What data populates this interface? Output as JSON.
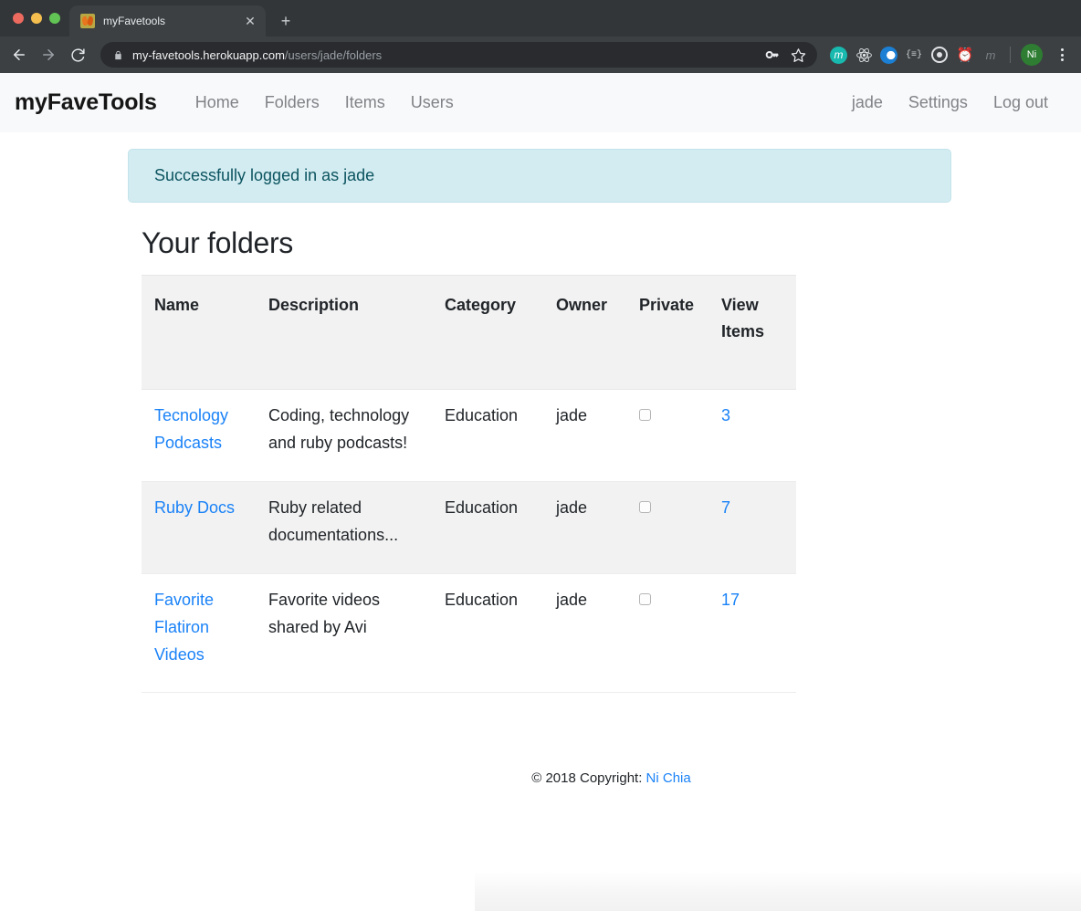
{
  "browser": {
    "tab": {
      "title": "myFavetools",
      "favicon_name": "butterfly-favicon",
      "close_label": "✕"
    },
    "new_tab_label": "+",
    "back_label": "←",
    "forward_label": "→",
    "reload_label": "⟳",
    "omnibox": {
      "domain": "my-favetools.herokuapp.com",
      "path": "/users/jade/folders",
      "lock_icon": "lock-icon"
    },
    "omnibox_actions": [
      {
        "name": "password-key-icon",
        "glyph": "⚷"
      },
      {
        "name": "bookmark-star-icon",
        "glyph": "☆"
      }
    ],
    "extensions": [
      {
        "name": "momentum-extension-icon",
        "glyph": "m"
      },
      {
        "name": "react-devtools-icon",
        "glyph": "⚛"
      },
      {
        "name": "opera-extension-icon",
        "glyph": ""
      },
      {
        "name": "json-formatter-icon",
        "glyph": "{≡}"
      },
      {
        "name": "target-extension-icon",
        "glyph": ""
      },
      {
        "name": "alarm-clock-extension-icon",
        "glyph": "⏰"
      },
      {
        "name": "muted-m-extension-icon",
        "glyph": "m"
      }
    ],
    "profile_initials": "Ni",
    "menu_name": "chrome-menu-kebab"
  },
  "navbar": {
    "brand": "myFaveTools",
    "links": [
      {
        "label": "Home",
        "name": "nav-link-home"
      },
      {
        "label": "Folders",
        "name": "nav-link-folders"
      },
      {
        "label": "Items",
        "name": "nav-link-items"
      },
      {
        "label": "Users",
        "name": "nav-link-users"
      }
    ],
    "right_links": [
      {
        "label": "jade",
        "name": "nav-link-user-jade"
      },
      {
        "label": "Settings",
        "name": "nav-link-settings"
      },
      {
        "label": "Log out",
        "name": "nav-link-logout"
      }
    ]
  },
  "alert": {
    "message": "Successfully logged in as jade",
    "bg_color": "#d3ecf1",
    "text_color": "#0c5460"
  },
  "main": {
    "title": "Your folders",
    "table": {
      "headers": [
        "Name",
        "Description",
        "Category",
        "Owner",
        "Private",
        "View Items"
      ],
      "rows": [
        {
          "name": "Tecnology Podcasts",
          "description": "Coding, technology and ruby podcasts!",
          "category": "Education",
          "owner": "jade",
          "private": false,
          "view_items": "3"
        },
        {
          "name": "Ruby Docs",
          "description": "Ruby related documentations...",
          "category": "Education",
          "owner": "jade",
          "private": false,
          "view_items": "7"
        },
        {
          "name": "Favorite Flatiron Videos",
          "description": "Favorite videos shared by Avi",
          "category": "Education",
          "owner": "jade",
          "private": false,
          "view_items": "17"
        }
      ]
    }
  },
  "footer": {
    "copyright": "© 2018 Copyright:",
    "author": "Ni Chia"
  },
  "colors": {
    "link": "#1a82f7",
    "navbar_bg": "#f8f9fa",
    "table_stripe": "#f2f2f2",
    "brand_text": "#161616"
  }
}
